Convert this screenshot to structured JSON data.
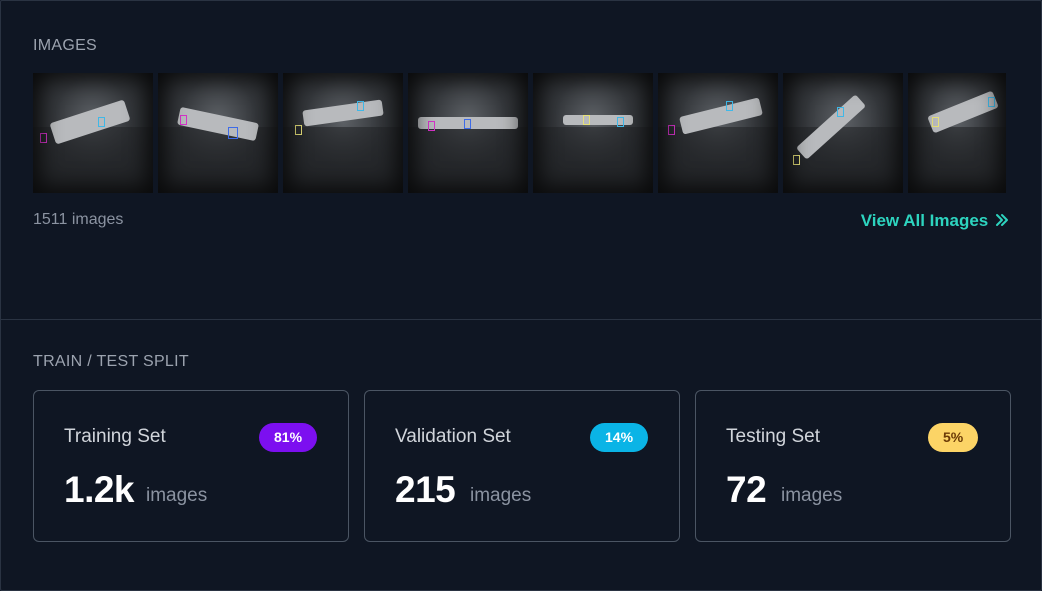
{
  "images_section": {
    "title": "IMAGES",
    "count_label": "1511 images",
    "view_all_label": "View All Images",
    "view_all_icon": "double-chevron-right-icon",
    "thumbnails": [
      {
        "name": "thumbnail-1"
      },
      {
        "name": "thumbnail-2"
      },
      {
        "name": "thumbnail-3"
      },
      {
        "name": "thumbnail-4"
      },
      {
        "name": "thumbnail-5"
      },
      {
        "name": "thumbnail-6"
      },
      {
        "name": "thumbnail-7"
      },
      {
        "name": "thumbnail-8"
      }
    ]
  },
  "split_section": {
    "title": "TRAIN / TEST SPLIT",
    "cards": [
      {
        "label": "Training Set",
        "badge": "81%",
        "value": "1.2k",
        "unit": "images",
        "badge_color": "#7c0ff0",
        "badge_text_color": "#ffffff"
      },
      {
        "label": "Validation Set",
        "badge": "14%",
        "value": "215",
        "unit": "images",
        "badge_color": "#0ab4e6",
        "badge_text_color": "#ffffff"
      },
      {
        "label": "Testing Set",
        "badge": "5%",
        "value": "72",
        "unit": "images",
        "badge_color": "#fcd466",
        "badge_text_color": "#6b3a06"
      }
    ]
  },
  "colors": {
    "background": "#0f1623",
    "accent": "#2dd4bf",
    "border": "#2a3342",
    "muted_text": "#8b93a1"
  }
}
